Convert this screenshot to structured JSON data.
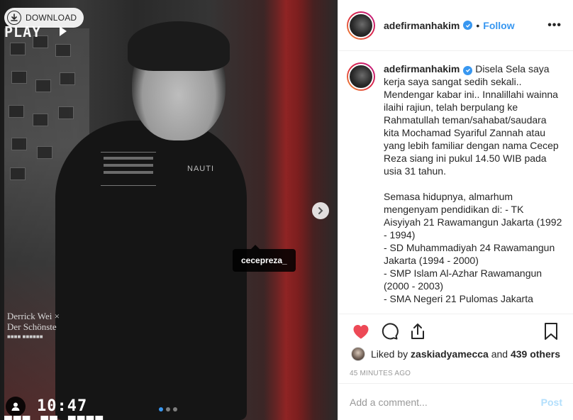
{
  "media": {
    "download_label": "DOWNLOAD",
    "vhs_play": "PLAY",
    "vhs_time": "10:47",
    "tag_username": "cecepreza_",
    "carousel": {
      "count": 3,
      "active_index": 0
    }
  },
  "post": {
    "username": "adefirmanhakim",
    "verified": true,
    "follow_label": "Follow",
    "separator": "•",
    "more_label": "•••"
  },
  "caption": {
    "username": "adefirmanhakim",
    "text": "Disela Sela saya kerja saya sangat sedih sekali.. Mendengar kabar ini.. Innalillahi wainna ilaihi rajiun, telah berpulang ke Rahmatullah teman/sahabat/saudara kita Mochamad Syariful Zannah atau yang lebih familiar dengan nama Cecep Reza siang ini pukul 14.50 WIB pada usia 31 tahun.\n\nSemasa hidupnya, almarhum mengenyam pendidikan di: - TK Aisyiyah 21 Rawamangun Jakarta (1992 - 1994)\n- SD Muhammadiyah 24 Rawamangun Jakarta (1994 - 2000)\n- SMP Islam Al-Azhar Rawamangun (2000 - 2003)\n- SMA Negeri 21 Pulomas Jakarta"
  },
  "actions": {
    "liked": true,
    "like_color": "#ed4956",
    "icons": [
      "heart-icon",
      "comment-icon",
      "share-icon",
      "bookmark-icon"
    ]
  },
  "likes": {
    "prefix": "Liked by",
    "first_user": "zaskiadyamecca",
    "and": "and",
    "others": "439 others"
  },
  "timestamp": "45 MINUTES AGO",
  "comment": {
    "placeholder": "Add a comment...",
    "post_label": "Post"
  },
  "colors": {
    "accent": "#3897f0",
    "post_disabled": "#b2dffc",
    "border": "#efefef",
    "muted": "#999999"
  }
}
